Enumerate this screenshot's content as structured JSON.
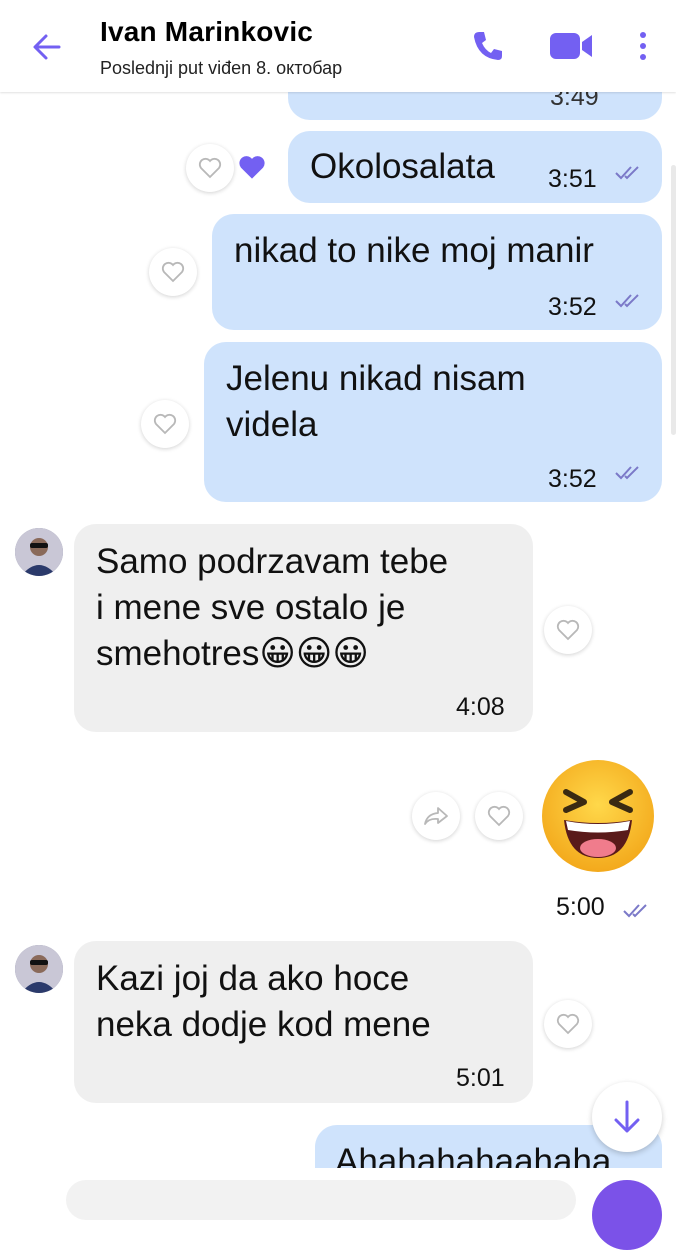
{
  "header": {
    "contact_name": "Ivan Marinkovic",
    "last_seen": "Poslednji put viđen 8. октобар",
    "accent": "#7360f2"
  },
  "messages": [
    {
      "direction": "out",
      "text": "",
      "time": "3:49",
      "partial": true
    },
    {
      "direction": "out",
      "text": "Okolosalata",
      "time": "3:51",
      "reaction": "filled-heart"
    },
    {
      "direction": "out",
      "text": "nikad to nike moj manir",
      "time": "3:52"
    },
    {
      "direction": "out",
      "text_line1": "Jelenu nikad nisam",
      "text_line2": "videla",
      "time": "3:52"
    },
    {
      "direction": "in",
      "text_line1": "Samo podrzavam tebe",
      "text_line2": "i mene sve ostalo je",
      "text_line3": "smehotres😀😀😀",
      "time": "4:08"
    },
    {
      "direction": "out",
      "type": "sticker",
      "emoji": "😆",
      "time": "5:00"
    },
    {
      "direction": "in",
      "text_line1": "Kazi joj da ako hoce",
      "text_line2": "neka dodje kod mene",
      "time": "5:01"
    },
    {
      "direction": "out",
      "text": "Ahahahahaahaha",
      "partial": true
    }
  ],
  "colors": {
    "outgoing_bubble": "#cfe3fc",
    "incoming_bubble": "#efefef",
    "tick_color": "#7b79c8"
  }
}
